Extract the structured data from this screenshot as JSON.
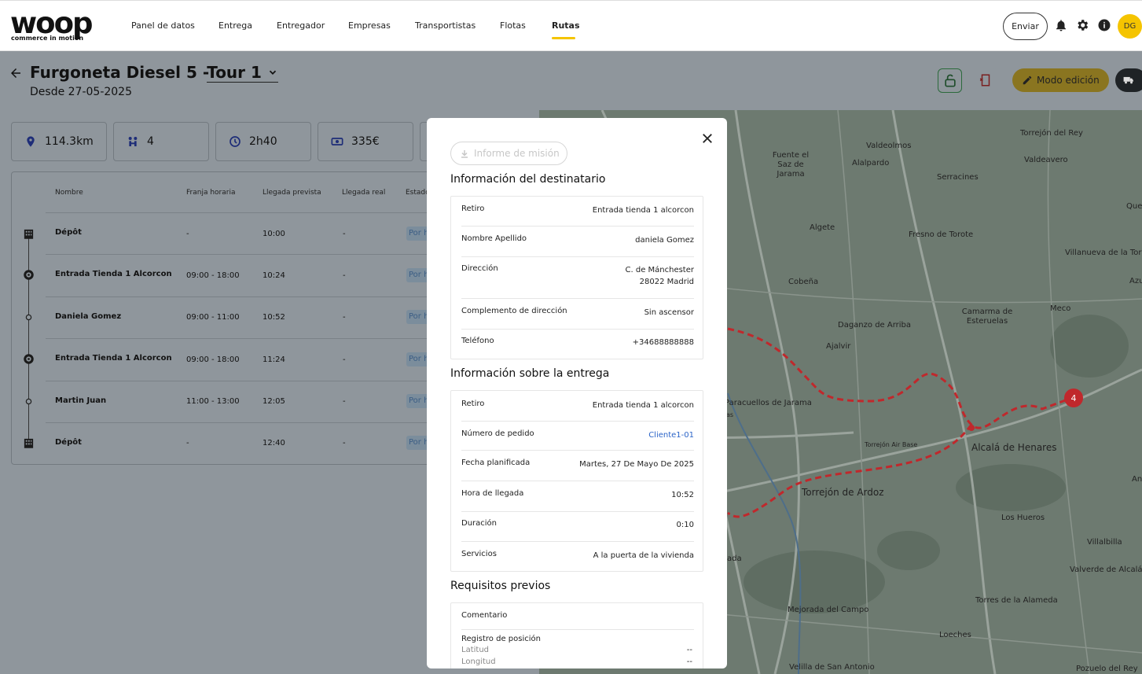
{
  "brand": {
    "logo_word": "woop",
    "tagline": "commerce in motion",
    "accent": "#f5c400"
  },
  "nav": {
    "items": [
      {
        "label": "Panel de datos"
      },
      {
        "label": "Entrega"
      },
      {
        "label": "Entregador"
      },
      {
        "label": "Empresas"
      },
      {
        "label": "Transportistas"
      },
      {
        "label": "Flotas"
      },
      {
        "label": "Rutas",
        "active": true
      }
    ],
    "send_button": "Enviar",
    "avatar_initials": "DG"
  },
  "route": {
    "title_prefix": "Furgoneta Diesel 5 -",
    "title_tour": "Tour 1",
    "since": "Desde 27-05-2025",
    "edit_mode": "Modo edición"
  },
  "stats": [
    {
      "icon": "location-pin-icon",
      "value": "114.3km"
    },
    {
      "icon": "stops-icon",
      "value": "4"
    },
    {
      "icon": "clock-icon",
      "value": "2h40"
    },
    {
      "icon": "money-icon",
      "value": "335€"
    }
  ],
  "table": {
    "headers": [
      "Nombre",
      "Franja horaria",
      "Llegada prevista",
      "Llegada real",
      "Estado"
    ],
    "rows": [
      {
        "icon": "depot-icon",
        "name": "Dépôt",
        "window": "-",
        "planned": "10:00",
        "actual": "-",
        "status": "Por hacer"
      },
      {
        "icon": "pickup-icon",
        "name": "Entrada Tienda 1 Alcorcon",
        "window": "09:00 - 18:00",
        "planned": "10:24",
        "actual": "-",
        "status": "Por hacer"
      },
      {
        "icon": "dot-icon",
        "name": "Daniela Gomez",
        "window": "09:00 - 11:00",
        "planned": "10:52",
        "actual": "-",
        "status": "Por hacer"
      },
      {
        "icon": "pickup-icon",
        "name": "Entrada Tienda 1 Alcorcon",
        "window": "09:00 - 18:00",
        "planned": "11:24",
        "actual": "-",
        "status": "Por hacer"
      },
      {
        "icon": "dot-icon",
        "name": "Martin Juan",
        "window": "11:00 - 13:00",
        "planned": "12:05",
        "actual": "-",
        "status": "Por hacer"
      },
      {
        "icon": "depot-icon",
        "name": "Dépôt",
        "window": "-",
        "planned": "12:40",
        "actual": "-",
        "status": "Por hacer"
      }
    ]
  },
  "map": {
    "labels": [
      "Torrejón del Rey",
      "Valdeolmos",
      "Fuente el Saz de Jarama",
      "Alalpardo",
      "Valdeavero",
      "Serracines",
      "Quer",
      "Algete",
      "Fresno de Torote",
      "Villanueva de la Torre",
      "Azuque",
      "Cobeña",
      "Camarma de Esteruelas",
      "Meco",
      "Daganzo de Arriba",
      "Ajalvir",
      "Paracuellos de Jarama",
      "Torrejón Air Base",
      "Alcalá de Henares",
      "And",
      "Torrejón de Ardoz",
      "Los Hueros",
      "Villalbilla",
      "Valverde de Alcalá",
      "ada",
      "Mejorada del Campo",
      "Torres de la Alameda",
      "Loeches",
      "Velilla de San Antonio",
      "Pozuelo del Rey",
      "as"
    ],
    "marker_number": "4",
    "route_color": "#c0282c"
  },
  "modal": {
    "report_button": "Informe de misión",
    "recipient": {
      "title": "Información del destinatario",
      "fields": [
        {
          "k": "Retiro",
          "v": "Entrada tienda 1 alcorcon"
        },
        {
          "k": "Nombre Apellido",
          "v": "daniela Gomez"
        },
        {
          "k": "Dirección",
          "v": "C. de Mánchester",
          "v2": "28022 Madrid"
        },
        {
          "k": "Complemento de dirección",
          "v": "Sin ascensor"
        },
        {
          "k": "Teléfono",
          "v": "+34688888888"
        }
      ]
    },
    "delivery": {
      "title": "Información sobre la entrega",
      "fields": [
        {
          "k": "Retiro",
          "v": "Entrada tienda 1 alcorcon"
        },
        {
          "k": "Número de pedido",
          "v": "Cliente1-01"
        },
        {
          "k": "Fecha planificada",
          "v": "Martes, 27 De Mayo De 2025"
        },
        {
          "k": "Hora de llegada",
          "v": "10:52"
        },
        {
          "k": "Duración",
          "v": "0:10"
        },
        {
          "k": "Servicios",
          "v": "A la puerta de la vivienda"
        }
      ]
    },
    "prereq": {
      "title": "Requisitos previos",
      "comment_label": "Comentario",
      "position_label": "Registro de posición",
      "lat_label": "Latitud",
      "lat_value": "--",
      "lng_label": "Longitud",
      "lng_value": "--"
    }
  }
}
